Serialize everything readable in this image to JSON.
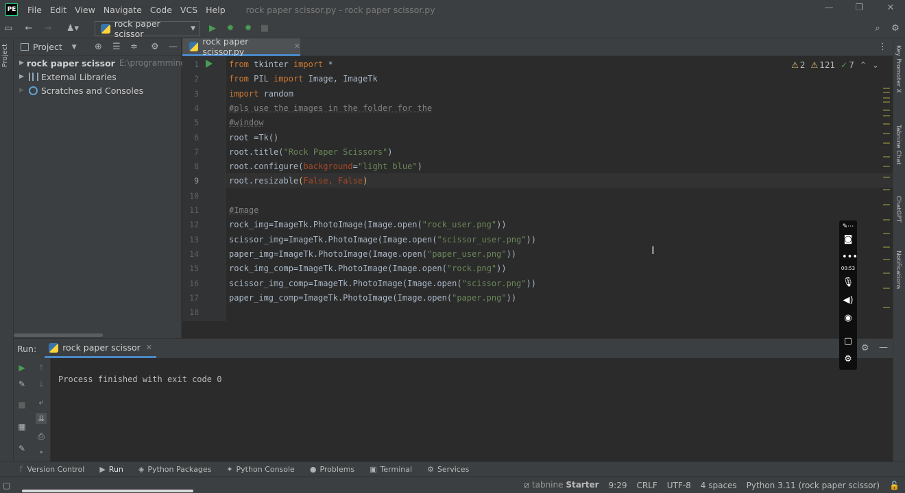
{
  "app": {
    "logo": "PE",
    "window_title": "rock paper scissor.py - rock paper scissor.py"
  },
  "menu": [
    "File",
    "Edit",
    "View",
    "Navigate",
    "Code",
    "VCS",
    "Help"
  ],
  "window_controls": {
    "minimize": "—",
    "restore": "❐",
    "close": "✕"
  },
  "toolbar": {
    "run_config": "rock paper scissor"
  },
  "left_strip": {
    "project_label": "Project"
  },
  "project": {
    "title": "Project",
    "root_name": "rock paper scissor",
    "root_path": "E:\\programming",
    "items": [
      "External Libraries",
      "Scratches and Consoles"
    ]
  },
  "editor": {
    "tab": "rock paper scissor.py",
    "inspections": {
      "warnings": "2",
      "weak_warnings": "121",
      "typos": "7"
    },
    "current_line": 9
  },
  "code_lines": [
    {
      "n": "1",
      "parts": [
        [
          "kw",
          "from"
        ],
        [
          "p",
          " tkinter "
        ],
        [
          "kw",
          "import"
        ],
        [
          "p",
          " *"
        ]
      ]
    },
    {
      "n": "2",
      "parts": [
        [
          "kw",
          "from"
        ],
        [
          "p",
          " PIL "
        ],
        [
          "kw",
          "import"
        ],
        [
          "p",
          " Image, ImageTk"
        ]
      ]
    },
    {
      "n": "3",
      "parts": [
        [
          "kw",
          "import"
        ],
        [
          "p",
          " random"
        ]
      ]
    },
    {
      "n": "4",
      "parts": [
        [
          "cm",
          "#pls use the images in the folder for the"
        ]
      ]
    },
    {
      "n": "5",
      "parts": [
        [
          "cm",
          "#window"
        ]
      ]
    },
    {
      "n": "6",
      "parts": [
        [
          "p",
          "root =Tk()"
        ]
      ]
    },
    {
      "n": "7",
      "parts": [
        [
          "p",
          "root.title("
        ],
        [
          "str",
          "\"Rock Paper Scissors\""
        ],
        [
          "p",
          ")"
        ]
      ]
    },
    {
      "n": "8",
      "parts": [
        [
          "p",
          "root.configure("
        ],
        [
          "arg",
          "background"
        ],
        [
          "p",
          "="
        ],
        [
          "str",
          "\"light blue\""
        ],
        [
          "p",
          ")"
        ]
      ]
    },
    {
      "n": "9",
      "parts": [
        [
          "p",
          "root.resizable"
        ],
        [
          "paren",
          "("
        ],
        [
          "arg",
          "False, False"
        ],
        [
          "paren",
          ")"
        ]
      ]
    },
    {
      "n": "10",
      "parts": [
        [
          "p",
          ""
        ]
      ]
    },
    {
      "n": "11",
      "parts": [
        [
          "cm",
          "#Image"
        ]
      ]
    },
    {
      "n": "12",
      "parts": [
        [
          "p",
          "rock_img=ImageTk.PhotoImage(Image.open("
        ],
        [
          "str",
          "\"rock_user.png\""
        ],
        [
          "p",
          "))"
        ]
      ]
    },
    {
      "n": "13",
      "parts": [
        [
          "p",
          "scissor_img=ImageTk.PhotoImage(Image.open("
        ],
        [
          "str",
          "\"scissor_user.png\""
        ],
        [
          "p",
          "))"
        ]
      ]
    },
    {
      "n": "14",
      "parts": [
        [
          "p",
          "paper_img=ImageTk.PhotoImage(Image.open("
        ],
        [
          "str",
          "\"paper_user.png\""
        ],
        [
          "p",
          "))"
        ]
      ]
    },
    {
      "n": "15",
      "parts": [
        [
          "p",
          "rock_img_comp=ImageTk.PhotoImage(Image.open("
        ],
        [
          "str",
          "\"rock.png\""
        ],
        [
          "p",
          "))"
        ]
      ]
    },
    {
      "n": "16",
      "parts": [
        [
          "p",
          "scissor_img_comp=ImageTk.PhotoImage(Image.open("
        ],
        [
          "str",
          "\"scissor.png\""
        ],
        [
          "p",
          "))"
        ]
      ]
    },
    {
      "n": "17",
      "parts": [
        [
          "p",
          "paper_img_comp=ImageTk.PhotoImage(Image.open("
        ],
        [
          "str",
          "\"paper.png\""
        ],
        [
          "p",
          "))"
        ]
      ]
    },
    {
      "n": "18",
      "parts": [
        [
          "p",
          ""
        ]
      ]
    }
  ],
  "right_strip": [
    "Key Promoter X",
    "Tabnine Chat",
    "ChatGPT",
    "Notifications"
  ],
  "run_panel": {
    "label": "Run:",
    "tab": "rock paper scissor",
    "output": "Process finished with exit code 0"
  },
  "recorder": {
    "time": "00:53"
  },
  "tool_windows": [
    {
      "label": "Version Control",
      "icon": "branch-icon",
      "glyph": "ᚴ"
    },
    {
      "label": "Run",
      "icon": "run-icon",
      "glyph": "▶",
      "active": true
    },
    {
      "label": "Python Packages",
      "icon": "packages-icon",
      "glyph": "◈"
    },
    {
      "label": "Python Console",
      "icon": "console-icon",
      "glyph": "✦"
    },
    {
      "label": "Problems",
      "icon": "problems-icon",
      "glyph": "●"
    },
    {
      "label": "Terminal",
      "icon": "terminal-icon",
      "glyph": "▣"
    },
    {
      "label": "Services",
      "icon": "services-icon",
      "glyph": "⚙"
    }
  ],
  "status": {
    "tabnine": "tabnine",
    "tabnine_plan": "Starter",
    "position": "9:29",
    "line_sep": "CRLF",
    "encoding": "UTF-8",
    "indent": "4 spaces",
    "interpreter": "Python 3.11 (rock paper scissor)"
  },
  "colors": {
    "accent": "#4a88c7",
    "run_green": "#499c54",
    "keyword": "#cc7832",
    "string": "#6a8759"
  }
}
